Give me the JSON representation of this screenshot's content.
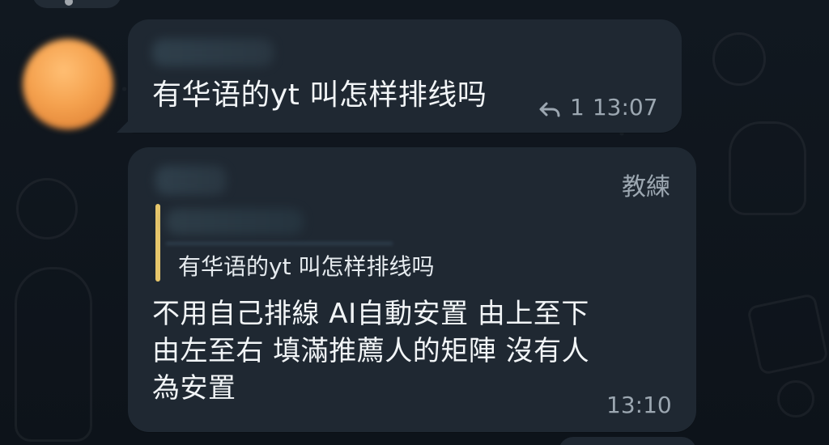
{
  "messages": [
    {
      "text": "有华语的yt 叫怎样排线吗",
      "reply_count": "1",
      "time": "13:07",
      "reply_icon": "reply-icon"
    },
    {
      "admin_label": "教練",
      "quote_text": "有华语的yt 叫怎样排线吗",
      "text_lines": [
        "不用自己排線 AI自動安置 由上至下",
        "由左至右 填滿推薦人的矩陣 沒有人",
        "為安置"
      ],
      "time": "13:10"
    }
  ],
  "colors": {
    "bubble": "#1f2832",
    "text": "#f2f5f7",
    "meta": "#9ca7b1",
    "quote_accent": "#e6c66b",
    "avatar": "#f5a24f"
  }
}
